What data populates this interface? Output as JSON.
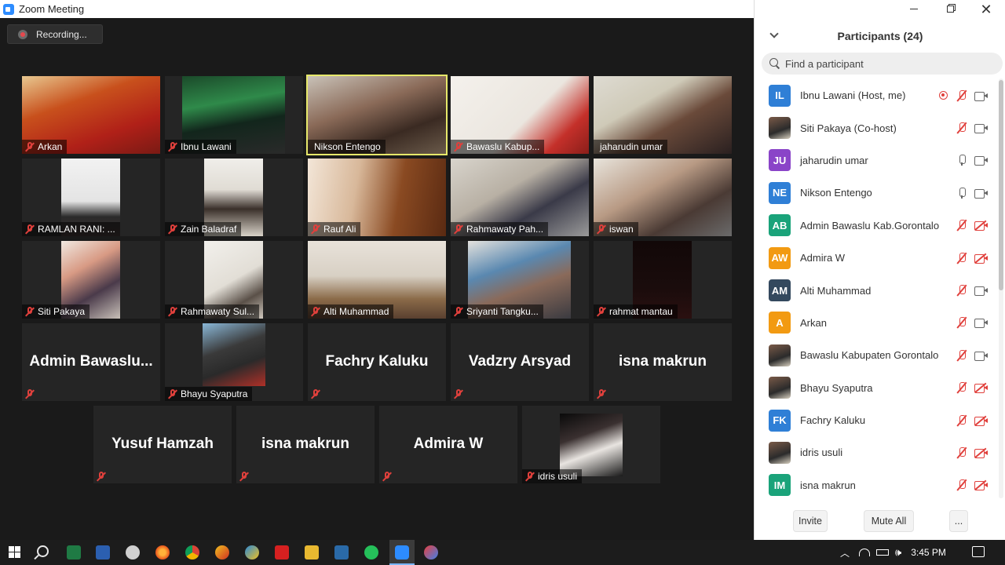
{
  "window": {
    "title": "Zoom Meeting"
  },
  "recording": {
    "label": "Recording..."
  },
  "gallery": {
    "tiles": [
      {
        "name": "Arkan",
        "type": "video"
      },
      {
        "name": "Ibnu Lawani",
        "type": "video"
      },
      {
        "name": "Nikson Entengo",
        "type": "video",
        "active": true
      },
      {
        "name": "Bawaslu Kabup...",
        "type": "video"
      },
      {
        "name": "jaharudin umar",
        "type": "video"
      },
      {
        "name": "RAMLAN RANI: ...",
        "type": "video"
      },
      {
        "name": "Zain Baladraf",
        "type": "video"
      },
      {
        "name": "Rauf Ali",
        "type": "video"
      },
      {
        "name": "Rahmawaty Pah...",
        "type": "video"
      },
      {
        "name": "iswan",
        "type": "video"
      },
      {
        "name": "Siti Pakaya",
        "type": "video"
      },
      {
        "name": "Rahmawaty Sul...",
        "type": "video"
      },
      {
        "name": "Alti Muhammad",
        "type": "video"
      },
      {
        "name": "Sriyanti Tangku...",
        "type": "video"
      },
      {
        "name": "rahmat mantau",
        "type": "video"
      },
      {
        "name": "Admin  Bawaslu...",
        "type": "name-only"
      },
      {
        "name": "Bhayu Syaputra",
        "type": "video"
      },
      {
        "name": "Fachry Kaluku",
        "type": "name-only"
      },
      {
        "name": "Vadzry Arsyad",
        "type": "name-only"
      },
      {
        "name": "isna makrun",
        "type": "name-only"
      },
      {
        "name": "Yusuf Hamzah",
        "type": "name-only"
      },
      {
        "name": "isna makrun",
        "type": "name-only"
      },
      {
        "name": "Admira W",
        "type": "name-only"
      },
      {
        "name": "idris usuli",
        "type": "video"
      }
    ]
  },
  "panel": {
    "title": "Participants (24)",
    "search_placeholder": "Find a participant",
    "participants": [
      {
        "initials": "IL",
        "color": "#2f7fd6",
        "name": "Ibnu Lawani (Host, me)",
        "recording": true,
        "mic": "off",
        "cam": "on"
      },
      {
        "initials": "",
        "photo": true,
        "name": "Siti Pakaya (Co-host)",
        "mic": "off",
        "cam": "on"
      },
      {
        "initials": "JU",
        "color": "#8a44c8",
        "name": "jaharudin umar",
        "mic": "on",
        "cam": "on"
      },
      {
        "initials": "NE",
        "color": "#2f7fd6",
        "name": "Nikson Entengo",
        "mic": "on",
        "cam": "on"
      },
      {
        "initials": "AB",
        "color": "#1aa37a",
        "name": "Admin Bawaslu Kab.Gorontalo",
        "mic": "off",
        "cam": "off"
      },
      {
        "initials": "AW",
        "color": "#f29a12",
        "name": "Admira W",
        "mic": "off",
        "cam": "off"
      },
      {
        "initials": "AM",
        "color": "#34495e",
        "name": "Alti Muhammad",
        "mic": "off",
        "cam": "on"
      },
      {
        "initials": "A",
        "color": "#f29a12",
        "name": "Arkan",
        "mic": "off",
        "cam": "on"
      },
      {
        "initials": "",
        "photo": true,
        "name": "Bawaslu Kabupaten Gorontalo",
        "mic": "off",
        "cam": "on"
      },
      {
        "initials": "",
        "photo": true,
        "name": "Bhayu Syaputra",
        "mic": "off",
        "cam": "off"
      },
      {
        "initials": "FK",
        "color": "#2f7fd6",
        "name": "Fachry Kaluku",
        "mic": "off",
        "cam": "off"
      },
      {
        "initials": "",
        "photo": true,
        "name": "idris usuli",
        "mic": "off",
        "cam": "off"
      },
      {
        "initials": "IM",
        "color": "#1aa37a",
        "name": "isna makrun",
        "mic": "off",
        "cam": "off"
      }
    ],
    "buttons": {
      "invite": "Invite",
      "mute_all": "Mute All",
      "more": "..."
    }
  },
  "taskbar": {
    "clock": "3:45 PM"
  }
}
